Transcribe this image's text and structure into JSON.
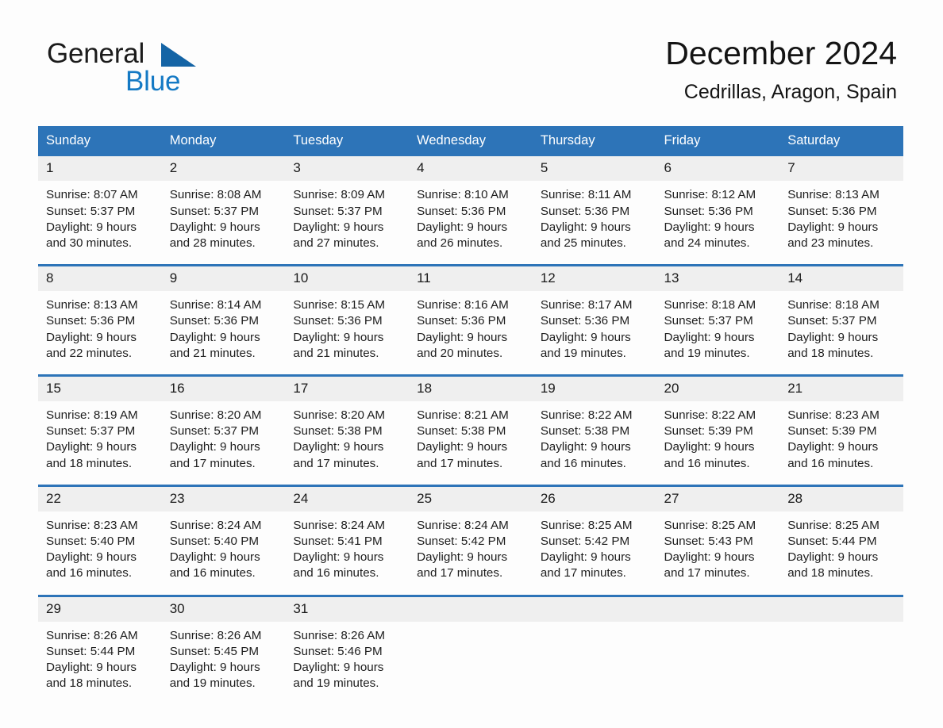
{
  "brand": {
    "name_part1": "General",
    "name_part2": "Blue",
    "triangle_color": "#1464a5",
    "blue_text_color": "#1479c4"
  },
  "header": {
    "title": "December 2024",
    "subtitle": "Cedrillas, Aragon, Spain"
  },
  "theme": {
    "header_blue": "#2d74b8",
    "daynum_band": "#efefef",
    "page_background": "#fdfdfd"
  },
  "weekday_headers": [
    "Sunday",
    "Monday",
    "Tuesday",
    "Wednesday",
    "Thursday",
    "Friday",
    "Saturday"
  ],
  "weeks": [
    {
      "days": [
        {
          "num": "1",
          "sunrise": "Sunrise: 8:07 AM",
          "sunset": "Sunset: 5:37 PM",
          "daylight_line1": "Daylight: 9 hours",
          "daylight_line2": "and 30 minutes."
        },
        {
          "num": "2",
          "sunrise": "Sunrise: 8:08 AM",
          "sunset": "Sunset: 5:37 PM",
          "daylight_line1": "Daylight: 9 hours",
          "daylight_line2": "and 28 minutes."
        },
        {
          "num": "3",
          "sunrise": "Sunrise: 8:09 AM",
          "sunset": "Sunset: 5:37 PM",
          "daylight_line1": "Daylight: 9 hours",
          "daylight_line2": "and 27 minutes."
        },
        {
          "num": "4",
          "sunrise": "Sunrise: 8:10 AM",
          "sunset": "Sunset: 5:36 PM",
          "daylight_line1": "Daylight: 9 hours",
          "daylight_line2": "and 26 minutes."
        },
        {
          "num": "5",
          "sunrise": "Sunrise: 8:11 AM",
          "sunset": "Sunset: 5:36 PM",
          "daylight_line1": "Daylight: 9 hours",
          "daylight_line2": "and 25 minutes."
        },
        {
          "num": "6",
          "sunrise": "Sunrise: 8:12 AM",
          "sunset": "Sunset: 5:36 PM",
          "daylight_line1": "Daylight: 9 hours",
          "daylight_line2": "and 24 minutes."
        },
        {
          "num": "7",
          "sunrise": "Sunrise: 8:13 AM",
          "sunset": "Sunset: 5:36 PM",
          "daylight_line1": "Daylight: 9 hours",
          "daylight_line2": "and 23 minutes."
        }
      ]
    },
    {
      "days": [
        {
          "num": "8",
          "sunrise": "Sunrise: 8:13 AM",
          "sunset": "Sunset: 5:36 PM",
          "daylight_line1": "Daylight: 9 hours",
          "daylight_line2": "and 22 minutes."
        },
        {
          "num": "9",
          "sunrise": "Sunrise: 8:14 AM",
          "sunset": "Sunset: 5:36 PM",
          "daylight_line1": "Daylight: 9 hours",
          "daylight_line2": "and 21 minutes."
        },
        {
          "num": "10",
          "sunrise": "Sunrise: 8:15 AM",
          "sunset": "Sunset: 5:36 PM",
          "daylight_line1": "Daylight: 9 hours",
          "daylight_line2": "and 21 minutes."
        },
        {
          "num": "11",
          "sunrise": "Sunrise: 8:16 AM",
          "sunset": "Sunset: 5:36 PM",
          "daylight_line1": "Daylight: 9 hours",
          "daylight_line2": "and 20 minutes."
        },
        {
          "num": "12",
          "sunrise": "Sunrise: 8:17 AM",
          "sunset": "Sunset: 5:36 PM",
          "daylight_line1": "Daylight: 9 hours",
          "daylight_line2": "and 19 minutes."
        },
        {
          "num": "13",
          "sunrise": "Sunrise: 8:18 AM",
          "sunset": "Sunset: 5:37 PM",
          "daylight_line1": "Daylight: 9 hours",
          "daylight_line2": "and 19 minutes."
        },
        {
          "num": "14",
          "sunrise": "Sunrise: 8:18 AM",
          "sunset": "Sunset: 5:37 PM",
          "daylight_line1": "Daylight: 9 hours",
          "daylight_line2": "and 18 minutes."
        }
      ]
    },
    {
      "days": [
        {
          "num": "15",
          "sunrise": "Sunrise: 8:19 AM",
          "sunset": "Sunset: 5:37 PM",
          "daylight_line1": "Daylight: 9 hours",
          "daylight_line2": "and 18 minutes."
        },
        {
          "num": "16",
          "sunrise": "Sunrise: 8:20 AM",
          "sunset": "Sunset: 5:37 PM",
          "daylight_line1": "Daylight: 9 hours",
          "daylight_line2": "and 17 minutes."
        },
        {
          "num": "17",
          "sunrise": "Sunrise: 8:20 AM",
          "sunset": "Sunset: 5:38 PM",
          "daylight_line1": "Daylight: 9 hours",
          "daylight_line2": "and 17 minutes."
        },
        {
          "num": "18",
          "sunrise": "Sunrise: 8:21 AM",
          "sunset": "Sunset: 5:38 PM",
          "daylight_line1": "Daylight: 9 hours",
          "daylight_line2": "and 17 minutes."
        },
        {
          "num": "19",
          "sunrise": "Sunrise: 8:22 AM",
          "sunset": "Sunset: 5:38 PM",
          "daylight_line1": "Daylight: 9 hours",
          "daylight_line2": "and 16 minutes."
        },
        {
          "num": "20",
          "sunrise": "Sunrise: 8:22 AM",
          "sunset": "Sunset: 5:39 PM",
          "daylight_line1": "Daylight: 9 hours",
          "daylight_line2": "and 16 minutes."
        },
        {
          "num": "21",
          "sunrise": "Sunrise: 8:23 AM",
          "sunset": "Sunset: 5:39 PM",
          "daylight_line1": "Daylight: 9 hours",
          "daylight_line2": "and 16 minutes."
        }
      ]
    },
    {
      "days": [
        {
          "num": "22",
          "sunrise": "Sunrise: 8:23 AM",
          "sunset": "Sunset: 5:40 PM",
          "daylight_line1": "Daylight: 9 hours",
          "daylight_line2": "and 16 minutes."
        },
        {
          "num": "23",
          "sunrise": "Sunrise: 8:24 AM",
          "sunset": "Sunset: 5:40 PM",
          "daylight_line1": "Daylight: 9 hours",
          "daylight_line2": "and 16 minutes."
        },
        {
          "num": "24",
          "sunrise": "Sunrise: 8:24 AM",
          "sunset": "Sunset: 5:41 PM",
          "daylight_line1": "Daylight: 9 hours",
          "daylight_line2": "and 16 minutes."
        },
        {
          "num": "25",
          "sunrise": "Sunrise: 8:24 AM",
          "sunset": "Sunset: 5:42 PM",
          "daylight_line1": "Daylight: 9 hours",
          "daylight_line2": "and 17 minutes."
        },
        {
          "num": "26",
          "sunrise": "Sunrise: 8:25 AM",
          "sunset": "Sunset: 5:42 PM",
          "daylight_line1": "Daylight: 9 hours",
          "daylight_line2": "and 17 minutes."
        },
        {
          "num": "27",
          "sunrise": "Sunrise: 8:25 AM",
          "sunset": "Sunset: 5:43 PM",
          "daylight_line1": "Daylight: 9 hours",
          "daylight_line2": "and 17 minutes."
        },
        {
          "num": "28",
          "sunrise": "Sunrise: 8:25 AM",
          "sunset": "Sunset: 5:44 PM",
          "daylight_line1": "Daylight: 9 hours",
          "daylight_line2": "and 18 minutes."
        }
      ]
    },
    {
      "days": [
        {
          "num": "29",
          "sunrise": "Sunrise: 8:26 AM",
          "sunset": "Sunset: 5:44 PM",
          "daylight_line1": "Daylight: 9 hours",
          "daylight_line2": "and 18 minutes."
        },
        {
          "num": "30",
          "sunrise": "Sunrise: 8:26 AM",
          "sunset": "Sunset: 5:45 PM",
          "daylight_line1": "Daylight: 9 hours",
          "daylight_line2": "and 19 minutes."
        },
        {
          "num": "31",
          "sunrise": "Sunrise: 8:26 AM",
          "sunset": "Sunset: 5:46 PM",
          "daylight_line1": "Daylight: 9 hours",
          "daylight_line2": "and 19 minutes."
        },
        {
          "num": "",
          "sunrise": "",
          "sunset": "",
          "daylight_line1": "",
          "daylight_line2": ""
        },
        {
          "num": "",
          "sunrise": "",
          "sunset": "",
          "daylight_line1": "",
          "daylight_line2": ""
        },
        {
          "num": "",
          "sunrise": "",
          "sunset": "",
          "daylight_line1": "",
          "daylight_line2": ""
        },
        {
          "num": "",
          "sunrise": "",
          "sunset": "",
          "daylight_line1": "",
          "daylight_line2": ""
        }
      ]
    }
  ]
}
